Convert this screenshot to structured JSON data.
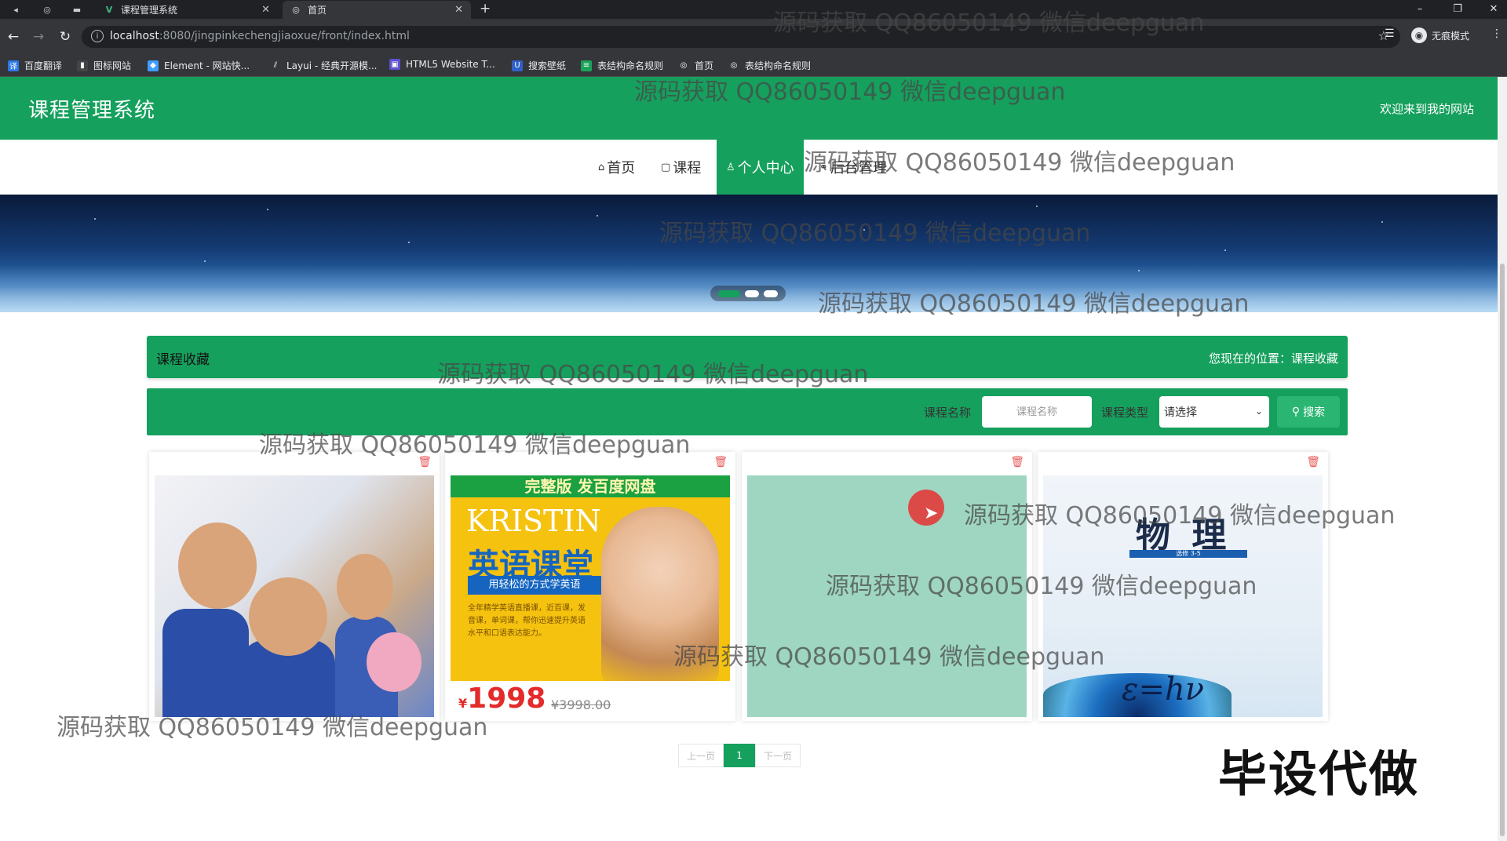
{
  "browser": {
    "tabs": [
      {
        "title": "课程管理系统",
        "icon": "vue-icon"
      },
      {
        "title": "首页",
        "icon": "globe-icon"
      }
    ],
    "url_host": "localhost",
    "url_path": ":8080/jingpinkechengjiaoxue/front/index.html",
    "profile_label": "无痕模式",
    "bookmarks": [
      "百度翻译",
      "图标网站",
      "Element - 网站快...",
      "Layui - 经典开源模...",
      "HTML5 Website T...",
      "搜索壁纸",
      "表结构命名规则",
      "首页",
      "表结构命名规则"
    ]
  },
  "header": {
    "title": "课程管理系统",
    "welcome": "欢迎来到我的网站"
  },
  "nav": [
    {
      "label": "首页",
      "icon": "home-icon"
    },
    {
      "label": "课程",
      "icon": "book-icon"
    },
    {
      "label": "个人中心",
      "icon": "user-icon",
      "active": true
    },
    {
      "label": "后台管理",
      "icon": "link-icon"
    }
  ],
  "carousel": {
    "slides": 3,
    "active_index": 0
  },
  "breadcrumb": {
    "title": "课程收藏",
    "location_label": "您现在的位置：课程收藏"
  },
  "search": {
    "name_label": "课程名称",
    "name_placeholder": "课程名称",
    "type_label": "课程类型",
    "type_value": "请选择",
    "button_label": "搜索"
  },
  "cards": [
    {
      "image": "kids-classroom-photo"
    },
    {
      "image": "english-course-poster",
      "band": "完整版 发百度网盘",
      "brand": "KRISTIN",
      "title": "英语课堂",
      "subtitle": "用轻松的方式学英语",
      "desc": "全年精学英语直播课，近百课，发音课，单词课，帮你迅速提升英语水平和口语表达能力。",
      "price": "1998",
      "currency": "¥",
      "old_price": "¥3998.00"
    },
    {
      "image": "blank-thumbnail"
    },
    {
      "image": "physics-textbook-cover",
      "title": "物 理",
      "sub": "选修 3-5",
      "equation": "ε=hν"
    }
  ],
  "pager": {
    "prev": "上一页",
    "current": "1",
    "next": "下一页"
  },
  "stamp": "毕设代做",
  "watermark": "源码获取 QQ86050149 微信deepguan",
  "colors": {
    "primary": "#16a05d",
    "accent": "#2ab672",
    "delete": "#e85b5b"
  }
}
